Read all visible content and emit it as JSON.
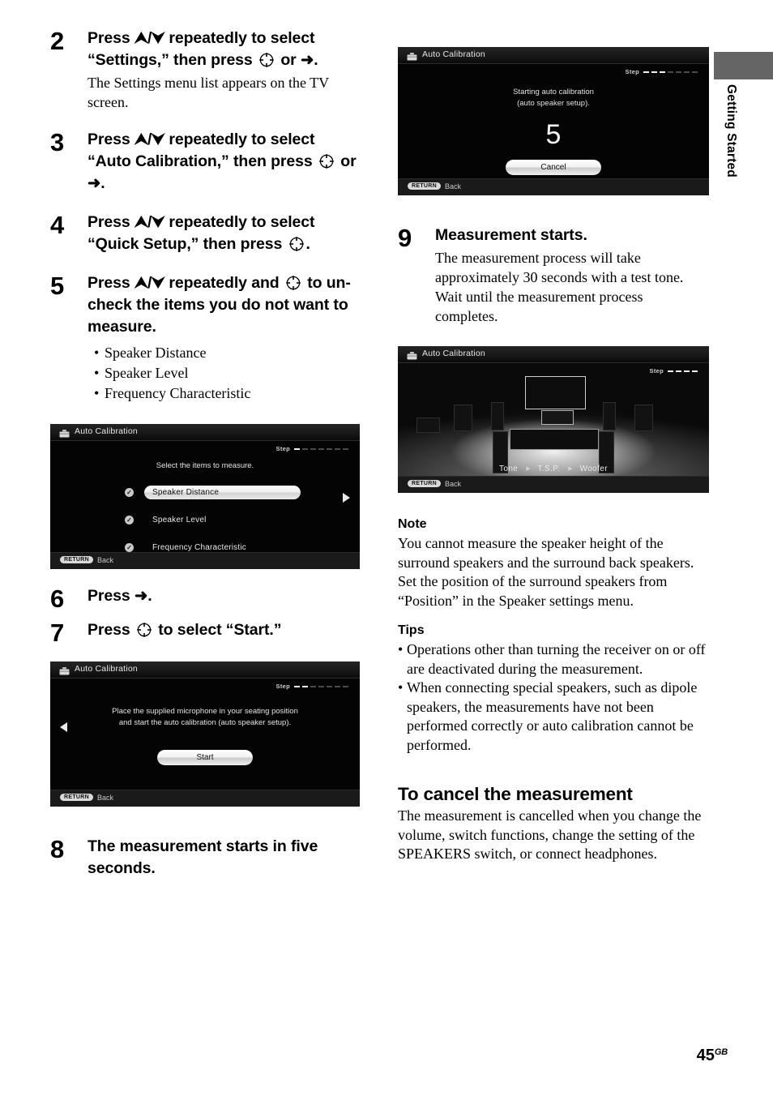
{
  "page": {
    "number": "45",
    "number_suffix": "GB",
    "side_tab_label": "Getting Started"
  },
  "left_column": {
    "steps": [
      {
        "num": "2",
        "title_part1": "Press ",
        "arrows": "⮝/⮟",
        "title_part2": " repeatedly to select “Settings,” then press ",
        "title_part3": " or ",
        "right_arrow": "➜",
        "title_part4": ".",
        "desc": "The Settings menu list appears on the TV screen."
      },
      {
        "num": "3",
        "title_part1": "Press ",
        "arrows": "⮝/⮟",
        "title_part2": " repeatedly to select “Auto Calibration,” then press ",
        "title_part3": " or ",
        "right_arrow": "➜",
        "title_part4": "."
      },
      {
        "num": "4",
        "title_part1": "Press ",
        "arrows": "⮝/⮟",
        "title_part2": " repeatedly to select “Quick Setup,” then press ",
        "title_part4": "."
      },
      {
        "num": "5",
        "title_part1": "Press ",
        "arrows": "⮝/⮟",
        "title_part2": " repeatedly and ",
        "title_part3": " to un-check the items you do not want to measure.",
        "bullets": [
          "Speaker Distance",
          "Speaker Level",
          "Frequency Characteristic"
        ]
      },
      {
        "num": "6",
        "title_part1": "Press ",
        "right_arrow": "➜",
        "title_part4": "."
      },
      {
        "num": "7",
        "title_part1": "Press ",
        "title_part3": " to select “Start.”"
      },
      {
        "num": "8",
        "title_plain": "The measurement starts in five seconds."
      }
    ]
  },
  "right_column": {
    "step9": {
      "num": "9",
      "title_plain": "Measurement starts.",
      "desc": "The measurement process will take approximately 30 seconds with a test tone. Wait until the measurement process completes."
    },
    "note": {
      "heading": "Note",
      "body": "You cannot measure the speaker height of the surround speakers and the surround back speakers. Set the position of the surround speakers from “Position” in the Speaker settings menu."
    },
    "tips": {
      "heading": "Tips",
      "items": [
        "Operations other than turning the receiver on or off are deactivated during the measurement.",
        "When connecting special speakers, such as dipole speakers, the measurements have not been performed correctly or auto calibration cannot be performed."
      ]
    },
    "cancel_section": {
      "heading": "To cancel the measurement",
      "body": "The measurement is cancelled when you change the volume, switch functions, change the setting of the SPEAKERS switch, or connect headphones."
    }
  },
  "screens": {
    "select_items": {
      "title": "Auto Calibration",
      "step_label": "Step",
      "step_total": 7,
      "step_filled": 1,
      "message": "Select the items to measure.",
      "options": [
        {
          "label": "Speaker Distance",
          "checked": true,
          "selected": true
        },
        {
          "label": "Speaker Level",
          "checked": true,
          "selected": false
        },
        {
          "label": "Frequency Characteristic",
          "checked": true,
          "selected": false
        }
      ],
      "return_badge": "RETURN",
      "return_text": "Back"
    },
    "start_screen": {
      "title": "Auto Calibration",
      "step_label": "Step",
      "step_total": 7,
      "step_filled": 2,
      "message_line1": "Place the supplied microphone in your seating position",
      "message_line2": "and start the auto calibration (auto speaker setup).",
      "button": "Start",
      "return_badge": "RETURN",
      "return_text": "Back"
    },
    "countdown": {
      "title": "Auto Calibration",
      "step_label": "Step",
      "step_total": 7,
      "step_filled": 3,
      "message_line1": "Starting auto calibration",
      "message_line2": "(auto speaker setup).",
      "countdown_value": "5",
      "button": "Cancel",
      "return_badge": "RETURN",
      "return_text": "Back"
    },
    "measuring": {
      "title": "Auto Calibration",
      "step_label": "Step",
      "step_total": 4,
      "step_filled": 4,
      "tone_sequence": [
        "Tone",
        "T.S.P.",
        "Woofer"
      ],
      "tone_separator": "➤",
      "return_badge": "RETURN",
      "return_text": "Back"
    }
  },
  "colors": {
    "side_tab": "#656565",
    "screen_bg": "#040404",
    "text": "#000000"
  }
}
